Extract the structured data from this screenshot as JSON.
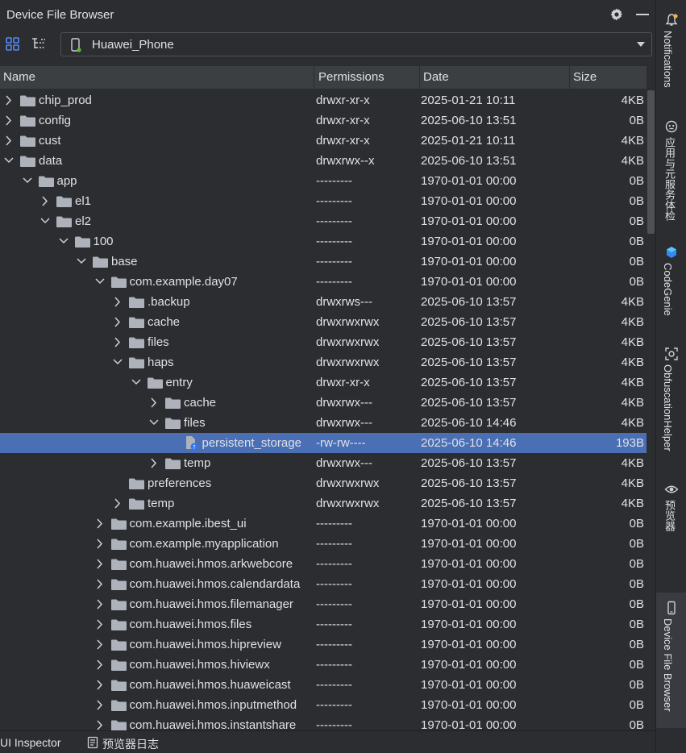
{
  "panel": {
    "title": "Device File Browser"
  },
  "device": {
    "name": "Huawei_Phone"
  },
  "columns": {
    "name": "Name",
    "permissions": "Permissions",
    "date": "Date",
    "size": "Size"
  },
  "rows": [
    {
      "name": "chip_prod",
      "perm": "drwxr-xr-x",
      "date": "2025-01-21 10:11",
      "size": "4KB",
      "depth": 0,
      "arrow": "right",
      "type": "folder"
    },
    {
      "name": "config",
      "perm": "drwxr-xr-x",
      "date": "2025-06-10 13:51",
      "size": "0B",
      "depth": 0,
      "arrow": "right",
      "type": "folder"
    },
    {
      "name": "cust",
      "perm": "drwxr-xr-x",
      "date": "2025-01-21 10:11",
      "size": "4KB",
      "depth": 0,
      "arrow": "right",
      "type": "folder"
    },
    {
      "name": "data",
      "perm": "drwxrwx--x",
      "date": "2025-06-10 13:51",
      "size": "4KB",
      "depth": 0,
      "arrow": "down",
      "type": "folder"
    },
    {
      "name": "app",
      "perm": "---------",
      "date": "1970-01-01 00:00",
      "size": "0B",
      "depth": 1,
      "arrow": "down",
      "type": "folder"
    },
    {
      "name": "el1",
      "perm": "---------",
      "date": "1970-01-01 00:00",
      "size": "0B",
      "depth": 2,
      "arrow": "right",
      "type": "folder"
    },
    {
      "name": "el2",
      "perm": "---------",
      "date": "1970-01-01 00:00",
      "size": "0B",
      "depth": 2,
      "arrow": "down",
      "type": "folder"
    },
    {
      "name": "100",
      "perm": "---------",
      "date": "1970-01-01 00:00",
      "size": "0B",
      "depth": 3,
      "arrow": "down",
      "type": "folder"
    },
    {
      "name": "base",
      "perm": "---------",
      "date": "1970-01-01 00:00",
      "size": "0B",
      "depth": 4,
      "arrow": "down",
      "type": "folder"
    },
    {
      "name": "com.example.day07",
      "perm": "---------",
      "date": "1970-01-01 00:00",
      "size": "0B",
      "depth": 5,
      "arrow": "down",
      "type": "folder"
    },
    {
      "name": ".backup",
      "perm": "drwxrws---",
      "date": "2025-06-10 13:57",
      "size": "4KB",
      "depth": 6,
      "arrow": "right",
      "type": "folder"
    },
    {
      "name": "cache",
      "perm": "drwxrwxrwx",
      "date": "2025-06-10 13:57",
      "size": "4KB",
      "depth": 6,
      "arrow": "right",
      "type": "folder"
    },
    {
      "name": "files",
      "perm": "drwxrwxrwx",
      "date": "2025-06-10 13:57",
      "size": "4KB",
      "depth": 6,
      "arrow": "right",
      "type": "folder"
    },
    {
      "name": "haps",
      "perm": "drwxrwxrwx",
      "date": "2025-06-10 13:57",
      "size": "4KB",
      "depth": 6,
      "arrow": "down",
      "type": "folder"
    },
    {
      "name": "entry",
      "perm": "drwxr-xr-x",
      "date": "2025-06-10 13:57",
      "size": "4KB",
      "depth": 7,
      "arrow": "down",
      "type": "folder"
    },
    {
      "name": "cache",
      "perm": "drwxrwx---",
      "date": "2025-06-10 13:57",
      "size": "4KB",
      "depth": 8,
      "arrow": "right",
      "type": "folder"
    },
    {
      "name": "files",
      "perm": "drwxrwx---",
      "date": "2025-06-10 14:46",
      "size": "4KB",
      "depth": 8,
      "arrow": "down",
      "type": "folder"
    },
    {
      "name": "persistent_storage",
      "perm": "-rw-rw----",
      "date": "2025-06-10 14:46",
      "size": "193B",
      "depth": 9,
      "arrow": "none",
      "type": "file",
      "selected": true
    },
    {
      "name": "temp",
      "perm": "drwxrwx---",
      "date": "2025-06-10 13:57",
      "size": "4KB",
      "depth": 8,
      "arrow": "right",
      "type": "folder"
    },
    {
      "name": "preferences",
      "perm": "drwxrwxrwx",
      "date": "2025-06-10 13:57",
      "size": "4KB",
      "depth": 6,
      "arrow": "none",
      "type": "folder"
    },
    {
      "name": "temp",
      "perm": "drwxrwxrwx",
      "date": "2025-06-10 13:57",
      "size": "4KB",
      "depth": 6,
      "arrow": "right",
      "type": "folder"
    },
    {
      "name": "com.example.ibest_ui",
      "perm": "---------",
      "date": "1970-01-01 00:00",
      "size": "0B",
      "depth": 5,
      "arrow": "right",
      "type": "folder"
    },
    {
      "name": "com.example.myapplication",
      "perm": "---------",
      "date": "1970-01-01 00:00",
      "size": "0B",
      "depth": 5,
      "arrow": "right",
      "type": "folder"
    },
    {
      "name": "com.huawei.hmos.arkwebcore",
      "perm": "---------",
      "date": "1970-01-01 00:00",
      "size": "0B",
      "depth": 5,
      "arrow": "right",
      "type": "folder"
    },
    {
      "name": "com.huawei.hmos.calendardata",
      "perm": "---------",
      "date": "1970-01-01 00:00",
      "size": "0B",
      "depth": 5,
      "arrow": "right",
      "type": "folder"
    },
    {
      "name": "com.huawei.hmos.filemanager",
      "perm": "---------",
      "date": "1970-01-01 00:00",
      "size": "0B",
      "depth": 5,
      "arrow": "right",
      "type": "folder"
    },
    {
      "name": "com.huawei.hmos.files",
      "perm": "---------",
      "date": "1970-01-01 00:00",
      "size": "0B",
      "depth": 5,
      "arrow": "right",
      "type": "folder"
    },
    {
      "name": "com.huawei.hmos.hipreview",
      "perm": "---------",
      "date": "1970-01-01 00:00",
      "size": "0B",
      "depth": 5,
      "arrow": "right",
      "type": "folder"
    },
    {
      "name": "com.huawei.hmos.hiviewx",
      "perm": "---------",
      "date": "1970-01-01 00:00",
      "size": "0B",
      "depth": 5,
      "arrow": "right",
      "type": "folder"
    },
    {
      "name": "com.huawei.hmos.huaweicast",
      "perm": "---------",
      "date": "1970-01-01 00:00",
      "size": "0B",
      "depth": 5,
      "arrow": "right",
      "type": "folder"
    },
    {
      "name": "com.huawei.hmos.inputmethod",
      "perm": "---------",
      "date": "1970-01-01 00:00",
      "size": "0B",
      "depth": 5,
      "arrow": "right",
      "type": "folder"
    },
    {
      "name": "com.huawei.hmos.instantshare",
      "perm": "---------",
      "date": "1970-01-01 00:00",
      "size": "0B",
      "depth": 5,
      "arrow": "right",
      "type": "folder"
    }
  ],
  "rightbar": {
    "items": [
      {
        "label": "Notifications",
        "icon": "bell-icon"
      },
      {
        "label": "应用与元服务体检",
        "icon": "robot-icon"
      },
      {
        "label": "CodeGenie",
        "icon": "codegenie-icon"
      },
      {
        "label": "ObfuscationHelper",
        "icon": "scan-icon"
      },
      {
        "label": "预览器",
        "icon": "eye-icon"
      },
      {
        "label": "Device File Browser",
        "icon": "phone-icon"
      }
    ]
  },
  "bottombar": {
    "items": [
      {
        "label": "UI Inspector"
      },
      {
        "label": "预览器日志",
        "icon": "log-icon"
      }
    ]
  },
  "colors": {
    "background": "#2b2d30",
    "header": "#3c3f41",
    "selection": "#4a6fb5",
    "folder": "#aeb3bb",
    "accent_green": "#5fb832"
  }
}
